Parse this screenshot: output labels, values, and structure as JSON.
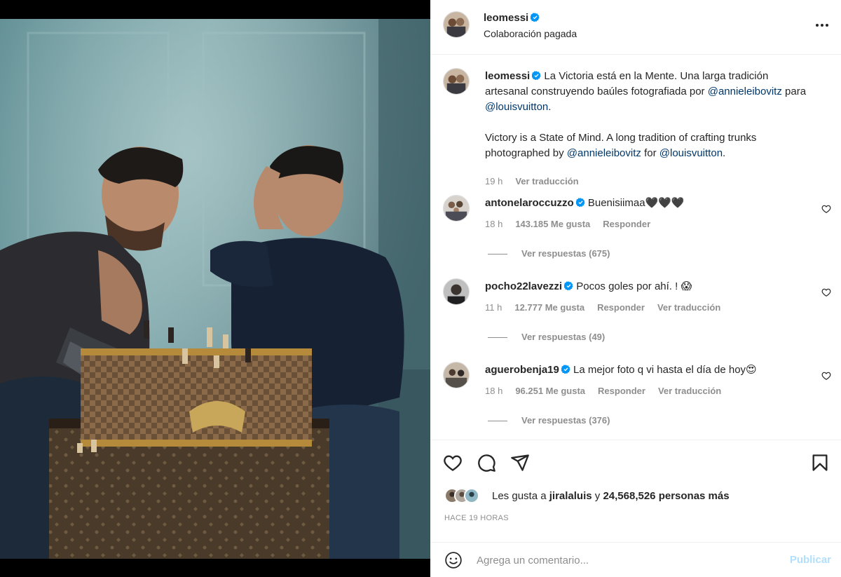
{
  "post": {
    "author": "leomessi",
    "subtitle": "Colaboración pagada",
    "more_icon": "more-horizontal-icon"
  },
  "caption": {
    "author": "leomessi",
    "es_text": "La Victoria está en la Mente. Una larga tradición artesanal construyendo baúles fotografiada por",
    "es_mention1": "@annieleibovitz",
    "es_mid": "para",
    "es_mention2": "@louisvuitton",
    "es_end": ".",
    "en_text": "Victory is a State of Mind. A long tradition of crafting trunks photographed by",
    "en_mention1": "@annieleibovitz",
    "en_mid": "for",
    "en_mention2": "@louisvuitton",
    "en_end": ".",
    "time": "19 h",
    "translate": "Ver traducción"
  },
  "comments": [
    {
      "user": "antonelaroccuzzo",
      "text": "Buenisiimaa🖤🖤🖤",
      "time": "18 h",
      "likes": "143.185 Me gusta",
      "reply": "Responder",
      "translate": "",
      "replies": "Ver respuestas (675)"
    },
    {
      "user": "pocho22lavezzi",
      "text": "Pocos goles por ahí. ! 😱",
      "time": "11 h",
      "likes": "12.777 Me gusta",
      "reply": "Responder",
      "translate": "Ver traducción",
      "replies": "Ver respuestas (49)"
    },
    {
      "user": "aguerobenja19",
      "text": "La mejor foto q vi hasta el día de hoy😍",
      "time": "18 h",
      "likes": "96.251 Me gusta",
      "reply": "Responder",
      "translate": "Ver traducción",
      "replies": "Ver respuestas (376)"
    }
  ],
  "actions": {
    "icons": [
      "heart-icon",
      "comment-icon",
      "share-icon",
      "bookmark-icon"
    ]
  },
  "likes": {
    "prefix": "Les gusta a",
    "user": "jiralaluis",
    "joiner": "y",
    "count": "24,568,526 personas más"
  },
  "timestamp": "HACE 19 HORAS",
  "add_comment": {
    "placeholder": "Agrega un comentario...",
    "post_label": "Publicar",
    "emoji_icon": "emoji-icon"
  },
  "colors": {
    "text": "#262626",
    "secondary": "#8e8e8e",
    "link": "#00376b",
    "verified": "#0095f6",
    "post_disabled": "#b2dffc"
  }
}
